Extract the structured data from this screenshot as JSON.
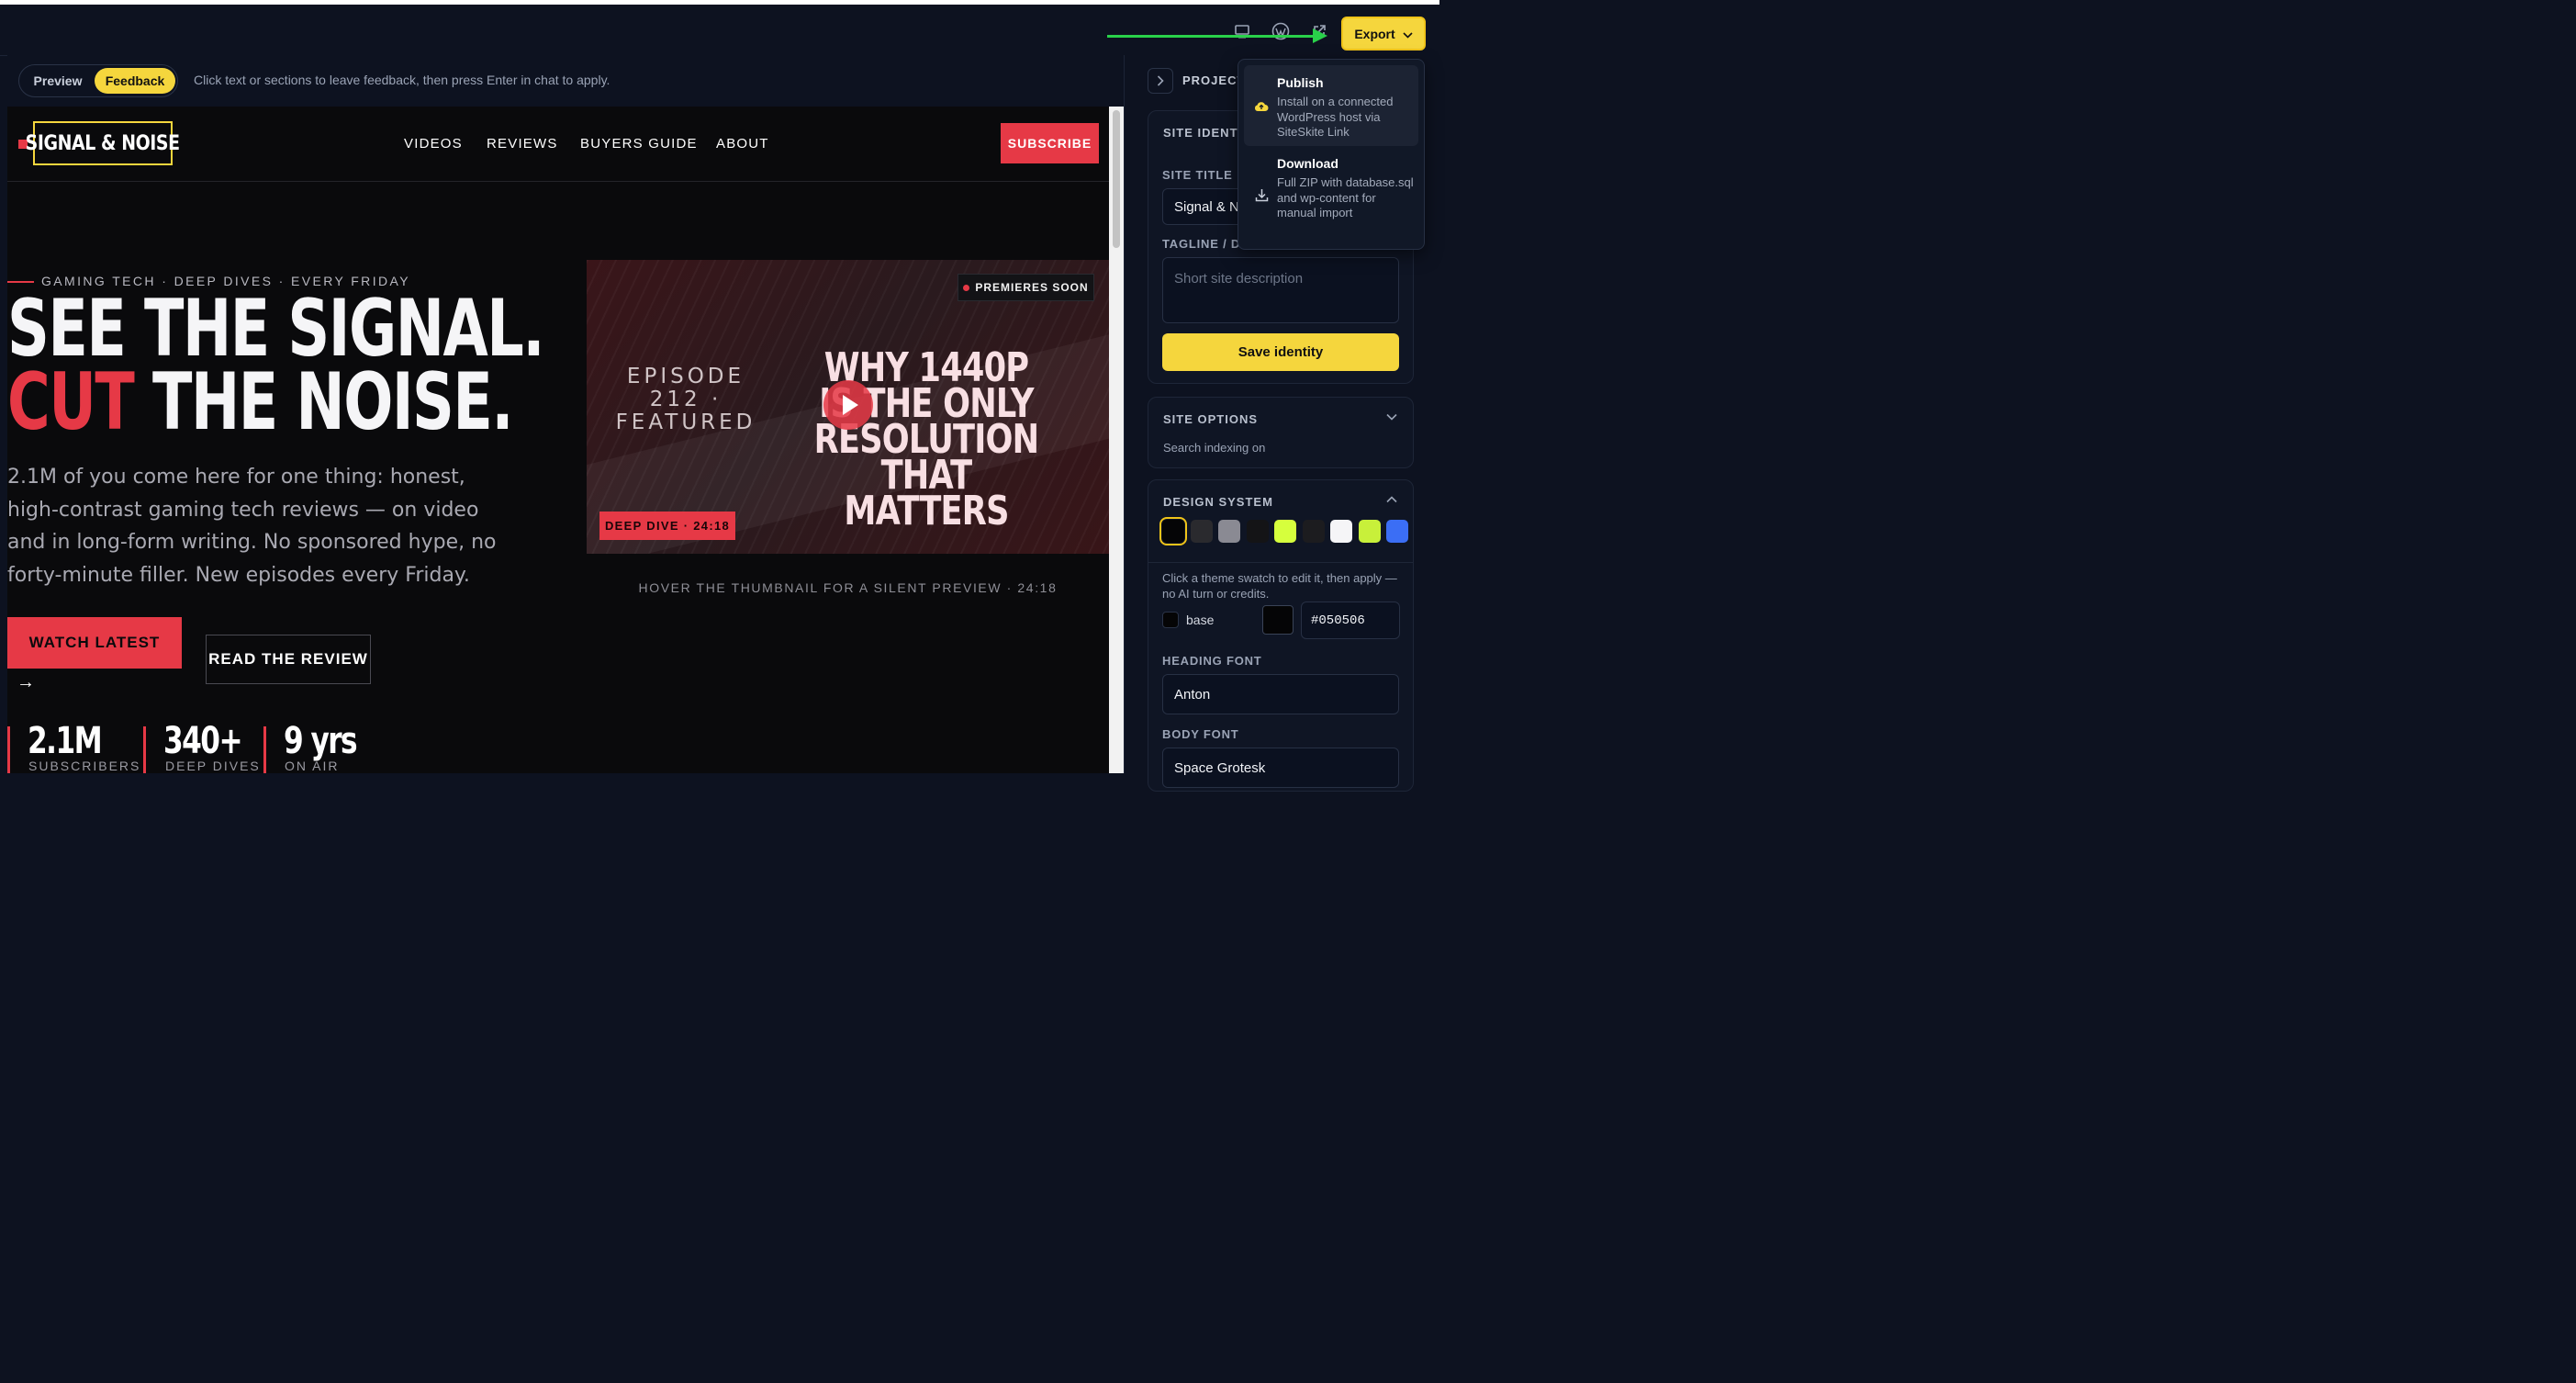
{
  "topbar": {
    "export_label": "Export"
  },
  "preview_toolbar": {
    "preview_label": "Preview",
    "feedback_label": "Feedback",
    "hint": "Click text or sections to leave feedback, then press Enter in chat to apply."
  },
  "site": {
    "logo": "SIGNAL & NOISE",
    "nav": [
      "VIDEOS",
      "REVIEWS",
      "BUYERS GUIDE",
      "ABOUT"
    ],
    "subscribe": "SUBSCRIBE",
    "eyebrow": "GAMING TECH · DEEP DIVES · EVERY FRIDAY",
    "headline_line1": "SEE THE SIGNAL.",
    "headline_cut": "CUT",
    "headline_line2_rest": " THE NOISE.",
    "hero_text": "2.1M of you come here for one thing: honest, high-contrast gaming tech reviews — on video and in long-form writing. No sponsored hype, no forty-minute filler. New episodes every Friday.",
    "watch_btn": "WATCH LATEST",
    "watch_arrow": "→",
    "review_btn": "READ THE REVIEW",
    "stats": [
      {
        "value": "2.1M",
        "label": "SUBSCRIBERS"
      },
      {
        "value": "340+",
        "label": "DEEP DIVES"
      },
      {
        "value": "9 yrs",
        "label": "ON AIR"
      }
    ],
    "thumbnail": {
      "badge": "PREMIERES SOON",
      "episode": "EPISODE 212 · FEATURED",
      "title": "WHY 1440P IS THE ONLY RESOLUTION THAT MATTERS",
      "tag": "DEEP DIVE · 24:18"
    },
    "thumb_caption": "HOVER THE THUMBNAIL FOR A SILENT PREVIEW · 24:18"
  },
  "panel": {
    "project_label": "PROJECT",
    "identity_title": "SITE IDENTIT",
    "site_title_label": "SITE TITLE",
    "site_title_value": "Signal & N",
    "tagline_label": "TAGLINE / DE",
    "tagline_placeholder": "Short site description",
    "save_identity": "Save identity",
    "site_options_title": "SITE OPTIONS",
    "site_options_sub": "Search indexing on",
    "design_system_title": "DESIGN SYSTEM",
    "swatches": [
      "#050506",
      "#2a2a2e",
      "#8a8a93",
      "#141416",
      "#d6ff3d",
      "#1c1c1f",
      "#f5f5f7",
      "#c8f03a",
      "#3b6ef5"
    ],
    "swatch_hint": "Click a theme swatch to edit it, then apply — no AI turn or credits.",
    "token_name": "base",
    "token_hex": "#050506",
    "heading_font_label": "HEADING FONT",
    "heading_font_value": "Anton",
    "body_font_label": "BODY FONT",
    "body_font_value": "Space Grotesk"
  },
  "export_menu": {
    "publish_title": "Publish",
    "publish_desc": "Install on a connected WordPress host via SiteSkite Link",
    "download_title": "Download",
    "download_desc": "Full ZIP with database.sql and wp-content for manual import"
  },
  "colors": {
    "accent_red": "#e63946",
    "accent_yellow": "#f5d63d",
    "arrow_green": "#29d14a"
  }
}
